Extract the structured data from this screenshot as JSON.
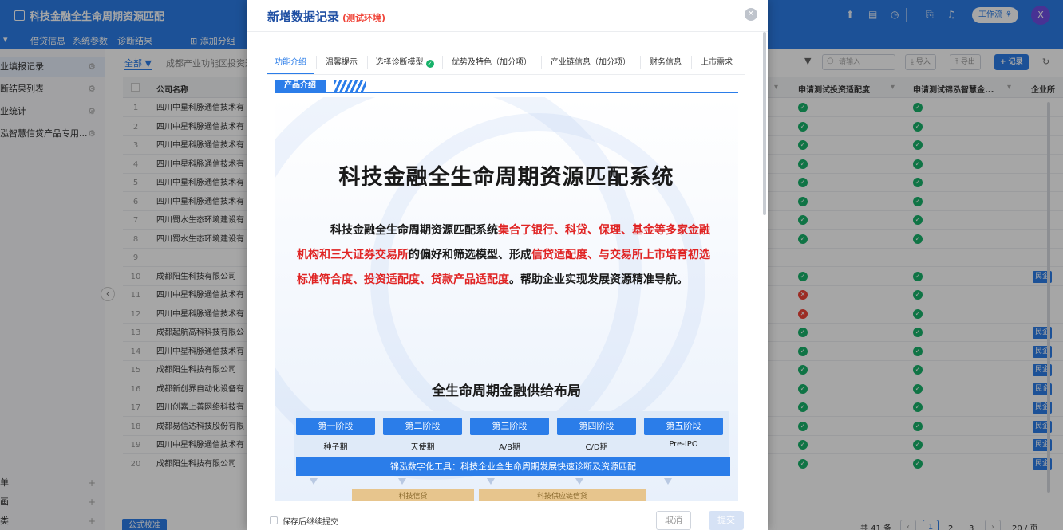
{
  "app": {
    "title": "科技金融全生命周期资源匹配",
    "workflow_label": "工作流",
    "avatar_initial": "X"
  },
  "tabs": [
    {
      "label": "▾"
    },
    {
      "label": "借贷信息"
    },
    {
      "label": "系统参数"
    },
    {
      "label": "诊断结果"
    },
    {
      "label": "添加分组"
    }
  ],
  "sidebar": {
    "items": [
      {
        "label": "业填报记录"
      },
      {
        "label": "断结果列表"
      },
      {
        "label": "业统计"
      },
      {
        "label": "泓智慧信贷产品专用..."
      }
    ],
    "bottom_items": [
      {
        "label": "单"
      },
      {
        "label": "画"
      },
      {
        "label": "类"
      }
    ]
  },
  "list": {
    "filter_all": "全部 ▼",
    "filter_crumb": "成都产业功能区投资过",
    "col_company": "公司名称",
    "col_invest": "申请测试投资适配度",
    "col_jinhong": "申请测试锦泓智慧金...",
    "col_enterprise": "企业所",
    "search_placeholder": "请输入",
    "import_label": "导入",
    "export_label": "导出",
    "add_record_label": "+ 记录",
    "rows": [
      {
        "num": "1",
        "name": "四川中星科脉通信技术有",
        "invest": "ok",
        "jinhong": "ok",
        "tag": ""
      },
      {
        "num": "2",
        "name": "四川中星科脉通信技术有",
        "invest": "ok",
        "jinhong": "ok",
        "tag": ""
      },
      {
        "num": "3",
        "name": "四川中星科脉通信技术有",
        "invest": "ok",
        "jinhong": "ok",
        "tag": ""
      },
      {
        "num": "4",
        "name": "四川中星科脉通信技术有",
        "invest": "ok",
        "jinhong": "ok",
        "tag": ""
      },
      {
        "num": "5",
        "name": "四川中星科脉通信技术有",
        "invest": "ok",
        "jinhong": "ok",
        "tag": ""
      },
      {
        "num": "6",
        "name": "四川中星科脉通信技术有",
        "invest": "ok",
        "jinhong": "ok",
        "tag": ""
      },
      {
        "num": "7",
        "name": "四川蜀水生态环境建设有",
        "invest": "ok",
        "jinhong": "ok",
        "tag": ""
      },
      {
        "num": "8",
        "name": "四川蜀水生态环境建设有",
        "invest": "ok",
        "jinhong": "ok",
        "tag": ""
      },
      {
        "num": "9",
        "name": "",
        "invest": "",
        "jinhong": "",
        "tag": ""
      },
      {
        "num": "10",
        "name": "成都阳生科技有限公司",
        "invest": "ok",
        "jinhong": "ok",
        "tag": "民企"
      },
      {
        "num": "11",
        "name": "四川中星科脉通信技术有",
        "invest": "fail",
        "jinhong": "ok",
        "tag": ""
      },
      {
        "num": "12",
        "name": "四川中星科脉通信技术有",
        "invest": "fail",
        "jinhong": "ok",
        "tag": ""
      },
      {
        "num": "13",
        "name": "成都起航高科科技有限公",
        "invest": "ok",
        "jinhong": "ok",
        "tag": "民企"
      },
      {
        "num": "14",
        "name": "四川中星科脉通信技术有",
        "invest": "ok",
        "jinhong": "ok",
        "tag": "民企"
      },
      {
        "num": "15",
        "name": "成都阳生科技有限公司",
        "invest": "ok",
        "jinhong": "ok",
        "tag": "民企"
      },
      {
        "num": "16",
        "name": "成都新创界自动化设备有",
        "invest": "ok",
        "jinhong": "ok",
        "tag": "民企"
      },
      {
        "num": "17",
        "name": "四川创嘉上善网络科技有",
        "invest": "ok",
        "jinhong": "ok",
        "tag": "民企"
      },
      {
        "num": "18",
        "name": "成都易信达科技股份有限",
        "invest": "ok",
        "jinhong": "ok",
        "tag": "民企"
      },
      {
        "num": "19",
        "name": "四川中星科脉通信技术有",
        "invest": "ok",
        "jinhong": "ok",
        "tag": "民企"
      },
      {
        "num": "20",
        "name": "成都阳生科技有限公司",
        "invest": "ok",
        "jinhong": "ok",
        "tag": "民企"
      }
    ],
    "total": "共 41 条",
    "pages": [
      "1",
      "2",
      "3"
    ],
    "page_size": "20 / 页",
    "formula_btn": "公式校准"
  },
  "modal": {
    "title": "新增数据记录",
    "env": "(测试环境)",
    "tabs": [
      {
        "label": "功能介绍"
      },
      {
        "label": "温馨提示"
      },
      {
        "label": "选择诊断模型"
      },
      {
        "label": "优势及特色（加分项）"
      },
      {
        "label": "产业链信息（加分项）"
      },
      {
        "label": "财务信息"
      },
      {
        "label": "上市需求"
      }
    ],
    "section": "产品介绍",
    "poster": {
      "title": "科技金融全生命周期资源匹配系统",
      "p_lead": "科技金融全生命周期资源匹配系统",
      "p_hl1": "集合了银行、科贷、保理、基金等多家金融机构和三大证券交易所",
      "p_mid": "的偏好和筛选模型、形成",
      "p_hl2": "信贷适配度、与交易所上市培育初选标准符合度、投资适配度、贷款产品适配度",
      "p_tail": "。帮助企业实现发展资源精准导航。",
      "layout_title": "全生命周期金融供给布局",
      "stages": [
        {
          "name": "第一阶段",
          "sub": "种子期"
        },
        {
          "name": "第二阶段",
          "sub": "天使期"
        },
        {
          "name": "第三阶段",
          "sub": "A/B期"
        },
        {
          "name": "第四阶段",
          "sub": "C/D期"
        },
        {
          "name": "第五阶段",
          "sub": "Pre-IPO"
        }
      ],
      "tool_strip": "锦泓数字化工具：科技企业全生命周期发展快速诊断及资源匹配",
      "gold_left": "科技信贷",
      "gold_right": "科技供应链信贷"
    },
    "save_continue": "保存后继续提交",
    "cancel": "取消",
    "submit": "提交"
  },
  "colors": {
    "primary": "#2b7de9",
    "success": "#17b26a",
    "danger": "#f04438",
    "title": "#1f4fa3"
  }
}
